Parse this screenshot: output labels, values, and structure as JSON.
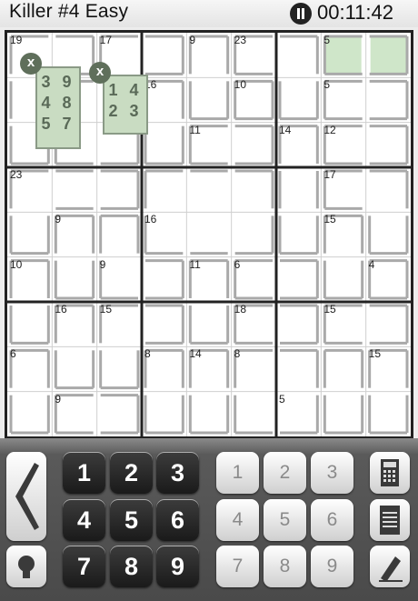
{
  "header": {
    "title": "Killer #4 Easy",
    "timer": "00:11:42"
  },
  "cages": [
    {
      "sum": "19",
      "cells": [
        [
          0,
          0
        ],
        [
          0,
          1
        ],
        [
          1,
          0
        ],
        [
          2,
          0
        ]
      ]
    },
    {
      "sum": "17",
      "cells": [
        [
          0,
          2
        ],
        [
          0,
          3
        ],
        [
          1,
          2
        ],
        [
          2,
          2
        ],
        [
          2,
          1
        ],
        [
          1,
          1
        ]
      ]
    },
    {
      "sum": "9",
      "cells": [
        [
          0,
          4
        ],
        [
          1,
          4
        ]
      ]
    },
    {
      "sum": "23",
      "cells": [
        [
          0,
          5
        ],
        [
          1,
          5
        ],
        [
          0,
          6
        ],
        [
          1,
          6
        ]
      ]
    },
    {
      "sum": "5",
      "cells": [
        [
          0,
          7
        ],
        [
          0,
          8
        ]
      ]
    },
    {
      "sum": "16",
      "cells": [
        [
          1,
          3
        ],
        [
          2,
          3
        ]
      ]
    },
    {
      "sum": "10",
      "cells": [
        [
          1,
          5
        ]
      ]
    },
    {
      "sum": "5",
      "cells": [
        [
          1,
          7
        ],
        [
          1,
          8
        ]
      ]
    },
    {
      "sum": "11",
      "cells": [
        [
          2,
          4
        ],
        [
          2,
          5
        ]
      ]
    },
    {
      "sum": "14",
      "cells": [
        [
          2,
          6
        ],
        [
          3,
          6
        ],
        [
          4,
          6
        ]
      ]
    },
    {
      "sum": "12",
      "cells": [
        [
          2,
          7
        ],
        [
          2,
          8
        ]
      ]
    },
    {
      "sum": "23",
      "cells": [
        [
          3,
          0
        ],
        [
          3,
          1
        ],
        [
          3,
          2
        ],
        [
          4,
          0
        ]
      ]
    },
    {
      "sum": "17",
      "cells": [
        [
          3,
          7
        ],
        [
          3,
          8
        ],
        [
          4,
          8
        ]
      ]
    },
    {
      "sum": "9",
      "cells": [
        [
          4,
          1
        ],
        [
          5,
          1
        ]
      ]
    },
    {
      "sum": "16",
      "cells": [
        [
          4,
          3
        ],
        [
          4,
          4
        ],
        [
          4,
          5
        ],
        [
          3,
          3
        ],
        [
          3,
          4
        ],
        [
          3,
          5
        ]
      ]
    },
    {
      "sum": "15",
      "cells": [
        [
          4,
          7
        ],
        [
          5,
          7
        ]
      ]
    },
    {
      "sum": "10",
      "cells": [
        [
          5,
          0
        ],
        [
          6,
          0
        ]
      ]
    },
    {
      "sum": "9",
      "cells": [
        [
          5,
          2
        ],
        [
          4,
          2
        ],
        [
          5,
          3
        ]
      ]
    },
    {
      "sum": "11",
      "cells": [
        [
          5,
          4
        ],
        [
          6,
          4
        ]
      ]
    },
    {
      "sum": "6",
      "cells": [
        [
          5,
          5
        ],
        [
          5,
          6
        ]
      ]
    },
    {
      "sum": "4",
      "cells": [
        [
          5,
          8
        ],
        [
          6,
          8
        ]
      ]
    },
    {
      "sum": "16",
      "cells": [
        [
          6,
          1
        ],
        [
          7,
          1
        ]
      ]
    },
    {
      "sum": "15",
      "cells": [
        [
          6,
          2
        ],
        [
          6,
          3
        ],
        [
          7,
          2
        ]
      ]
    },
    {
      "sum": "18",
      "cells": [
        [
          6,
          5
        ],
        [
          6,
          6
        ]
      ]
    },
    {
      "sum": "15",
      "cells": [
        [
          6,
          7
        ],
        [
          7,
          7
        ],
        [
          6,
          8
        ]
      ]
    },
    {
      "sum": "6",
      "cells": [
        [
          7,
          0
        ],
        [
          8,
          0
        ]
      ]
    },
    {
      "sum": "8",
      "cells": [
        [
          7,
          3
        ],
        [
          8,
          3
        ]
      ]
    },
    {
      "sum": "14",
      "cells": [
        [
          7,
          4
        ],
        [
          8,
          4
        ]
      ]
    },
    {
      "sum": "8",
      "cells": [
        [
          7,
          5
        ],
        [
          8,
          5
        ],
        [
          7,
          6
        ],
        [
          8,
          6
        ]
      ]
    },
    {
      "sum": "15",
      "cells": [
        [
          7,
          8
        ],
        [
          8,
          8
        ]
      ]
    },
    {
      "sum": "9",
      "cells": [
        [
          8,
          1
        ],
        [
          8,
          2
        ]
      ]
    },
    {
      "sum": "5",
      "cells": [
        [
          8,
          7
        ],
        [
          7,
          7
        ]
      ]
    }
  ],
  "clue_positions": [
    {
      "label": "19",
      "r": 0,
      "c": 0
    },
    {
      "label": "17",
      "r": 0,
      "c": 2
    },
    {
      "label": "9",
      "r": 0,
      "c": 4
    },
    {
      "label": "23",
      "r": 0,
      "c": 5
    },
    {
      "label": "5",
      "r": 0,
      "c": 7
    },
    {
      "label": "16",
      "r": 1,
      "c": 3
    },
    {
      "label": "10",
      "r": 1,
      "c": 5
    },
    {
      "label": "5",
      "r": 1,
      "c": 7
    },
    {
      "label": "11",
      "r": 2,
      "c": 4
    },
    {
      "label": "14",
      "r": 2,
      "c": 6
    },
    {
      "label": "12",
      "r": 2,
      "c": 7
    },
    {
      "label": "23",
      "r": 3,
      "c": 0
    },
    {
      "label": "17",
      "r": 3,
      "c": 7
    },
    {
      "label": "9",
      "r": 4,
      "c": 1
    },
    {
      "label": "16",
      "r": 4,
      "c": 3
    },
    {
      "label": "15",
      "r": 4,
      "c": 7
    },
    {
      "label": "10",
      "r": 5,
      "c": 0
    },
    {
      "label": "9",
      "r": 5,
      "c": 2
    },
    {
      "label": "11",
      "r": 5,
      "c": 4
    },
    {
      "label": "6",
      "r": 5,
      "c": 5
    },
    {
      "label": "4",
      "r": 5,
      "c": 8
    },
    {
      "label": "16",
      "r": 6,
      "c": 1
    },
    {
      "label": "15",
      "r": 6,
      "c": 2
    },
    {
      "label": "18",
      "r": 6,
      "c": 5
    },
    {
      "label": "15",
      "r": 6,
      "c": 7
    },
    {
      "label": "6",
      "r": 7,
      "c": 0
    },
    {
      "label": "8",
      "r": 7,
      "c": 3
    },
    {
      "label": "14",
      "r": 7,
      "c": 4
    },
    {
      "label": "8",
      "r": 7,
      "c": 5
    },
    {
      "label": "15",
      "r": 7,
      "c": 8
    },
    {
      "label": "9",
      "r": 8,
      "c": 1
    },
    {
      "label": "5",
      "r": 8,
      "c": 6
    }
  ],
  "highlighted_cells": [
    [
      0,
      7
    ],
    [
      0,
      8
    ]
  ],
  "highlight_color": "#cfe6c9",
  "notes": [
    {
      "text": "3 9\n4 8\n5 7",
      "close": "x"
    },
    {
      "text": "1 4\n2 3",
      "close": "x"
    }
  ],
  "keypad": {
    "numbers": [
      "1",
      "2",
      "3",
      "4",
      "5",
      "6",
      "7",
      "8",
      "9"
    ],
    "pencil": [
      "1",
      "2",
      "3",
      "4",
      "5",
      "6",
      "7",
      "8",
      "9"
    ]
  },
  "icons": [
    "back-arrow-icon",
    "hint-bulb-icon",
    "calculator-icon",
    "notepad-icon",
    "eraser-icon",
    "pause-icon"
  ]
}
